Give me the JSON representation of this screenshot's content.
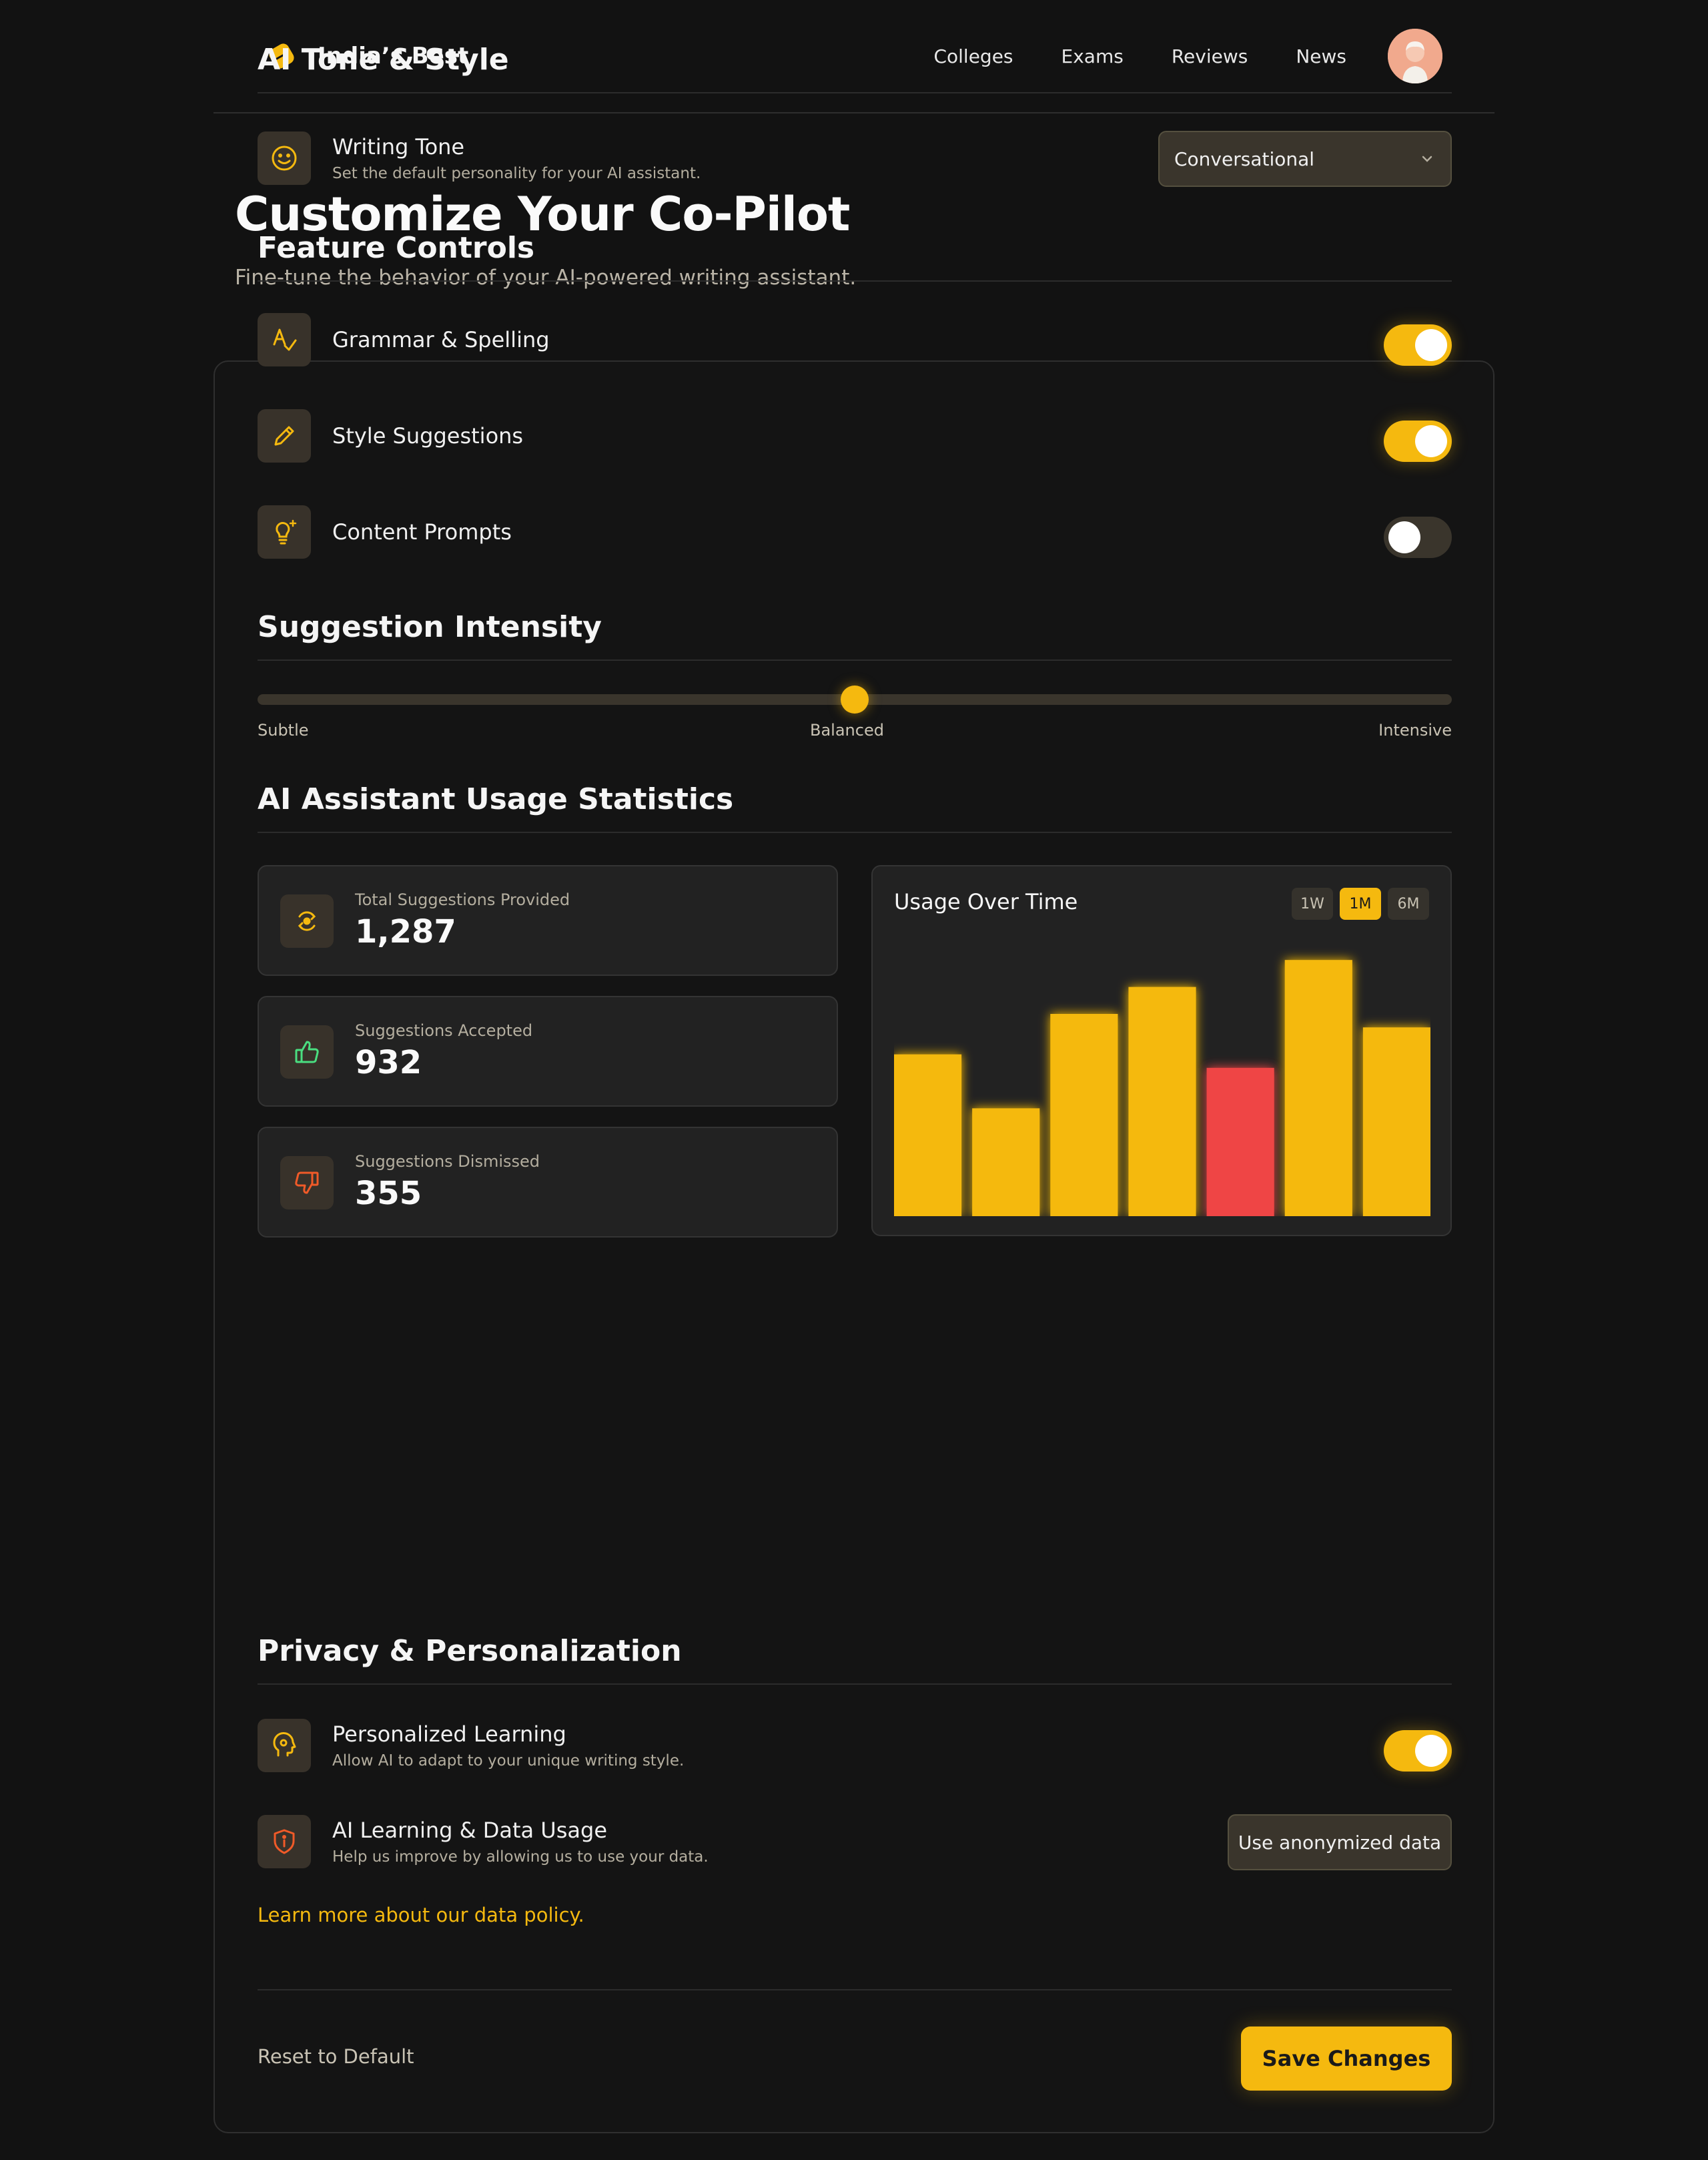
{
  "nav": {
    "brand": "India’s Best",
    "links": [
      "Colleges",
      "Exams",
      "Reviews",
      "News"
    ]
  },
  "header": {
    "title": "Customize Your Co-Pilot",
    "subtitle": "Fine-tune the behavior of your AI-powered writing assistant."
  },
  "tone": {
    "section_title": "AI Tone & Style",
    "label": "Writing Tone",
    "description": "Set the default personality for your AI assistant.",
    "selected": "Conversational"
  },
  "features": {
    "section_title": "Feature Controls",
    "items": [
      {
        "label": "Grammar & Spelling",
        "enabled": true
      },
      {
        "label": "Style Suggestions",
        "enabled": true
      },
      {
        "label": "Content Prompts",
        "enabled": false
      }
    ]
  },
  "intensity": {
    "section_title": "Suggestion Intensity",
    "labels": [
      "Subtle",
      "Balanced",
      "Intensive"
    ],
    "value": 0.5
  },
  "stats": {
    "section_title": "AI Assistant Usage Statistics",
    "cards": [
      {
        "label": "Total Suggestions Provided",
        "value": "1,287"
      },
      {
        "label": "Suggestions Accepted",
        "value": "932"
      },
      {
        "label": "Suggestions Dismissed",
        "value": "355"
      }
    ]
  },
  "chart_data": {
    "type": "bar",
    "title": "Usage Over Time",
    "ranges": [
      "1W",
      "1M",
      "6M"
    ],
    "active_range": "1M",
    "values": [
      60,
      40,
      75,
      85,
      55,
      95,
      70
    ],
    "ylim": [
      0,
      100
    ],
    "highlight_index": 4,
    "colors": {
      "bar": "#f5b90f",
      "highlight": "#ef4444"
    }
  },
  "privacy": {
    "section_title": "Privacy & Personalization",
    "personalized": {
      "label": "Personalized Learning",
      "description": "Allow AI to adapt to your unique writing style.",
      "enabled": true
    },
    "data_usage": {
      "label": "AI Learning & Data Usage",
      "description": "Help us improve by allowing us to use your data.",
      "button": "Use anonymized data"
    },
    "link": "Learn more about our data policy."
  },
  "footer": {
    "reset": "Reset to Default",
    "save": "Save Changes"
  },
  "colors": {
    "accent": "#f5b90f",
    "success": "#4ade80",
    "danger": "#f05a28",
    "background": "#121212"
  }
}
